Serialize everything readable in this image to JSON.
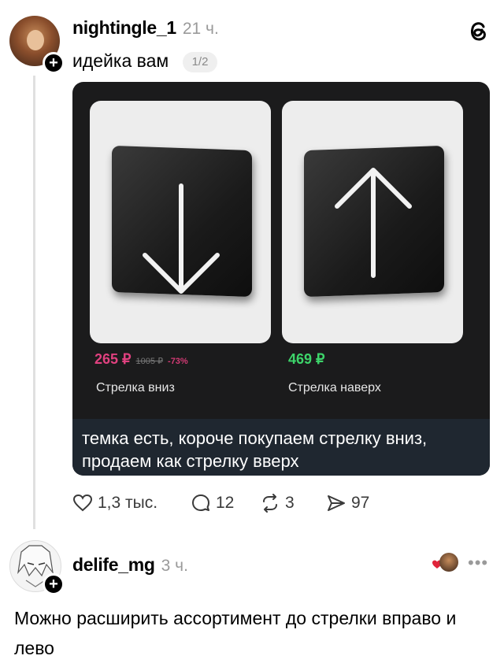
{
  "post": {
    "username": "nightingle_1",
    "time": "21 ч.",
    "text": "идейка вам",
    "pager": "1/2",
    "image": {
      "products": [
        {
          "price": "265 ₽",
          "old_price": "1005 ₽",
          "discount": "-73%",
          "name": "Стрелка вниз",
          "arrow": "arrow-down-icon"
        },
        {
          "price": "469 ₽",
          "name": "Стрелка наверх",
          "arrow": "arrow-up-icon"
        }
      ],
      "caption": "темка есть, короче покупаем стрелку вниз, продаем как стрелку вверх",
      "colors": {
        "price_discount": "#e0417f",
        "price_regular": "#3dd46a"
      }
    },
    "actions": {
      "likes": "1,3 тыс.",
      "comments": "12",
      "reposts": "3",
      "shares": "97"
    }
  },
  "reply": {
    "username": "delife_mg",
    "time": "3 ч.",
    "text": "Можно расширить ассортимент до стрелки вправо и лево"
  }
}
